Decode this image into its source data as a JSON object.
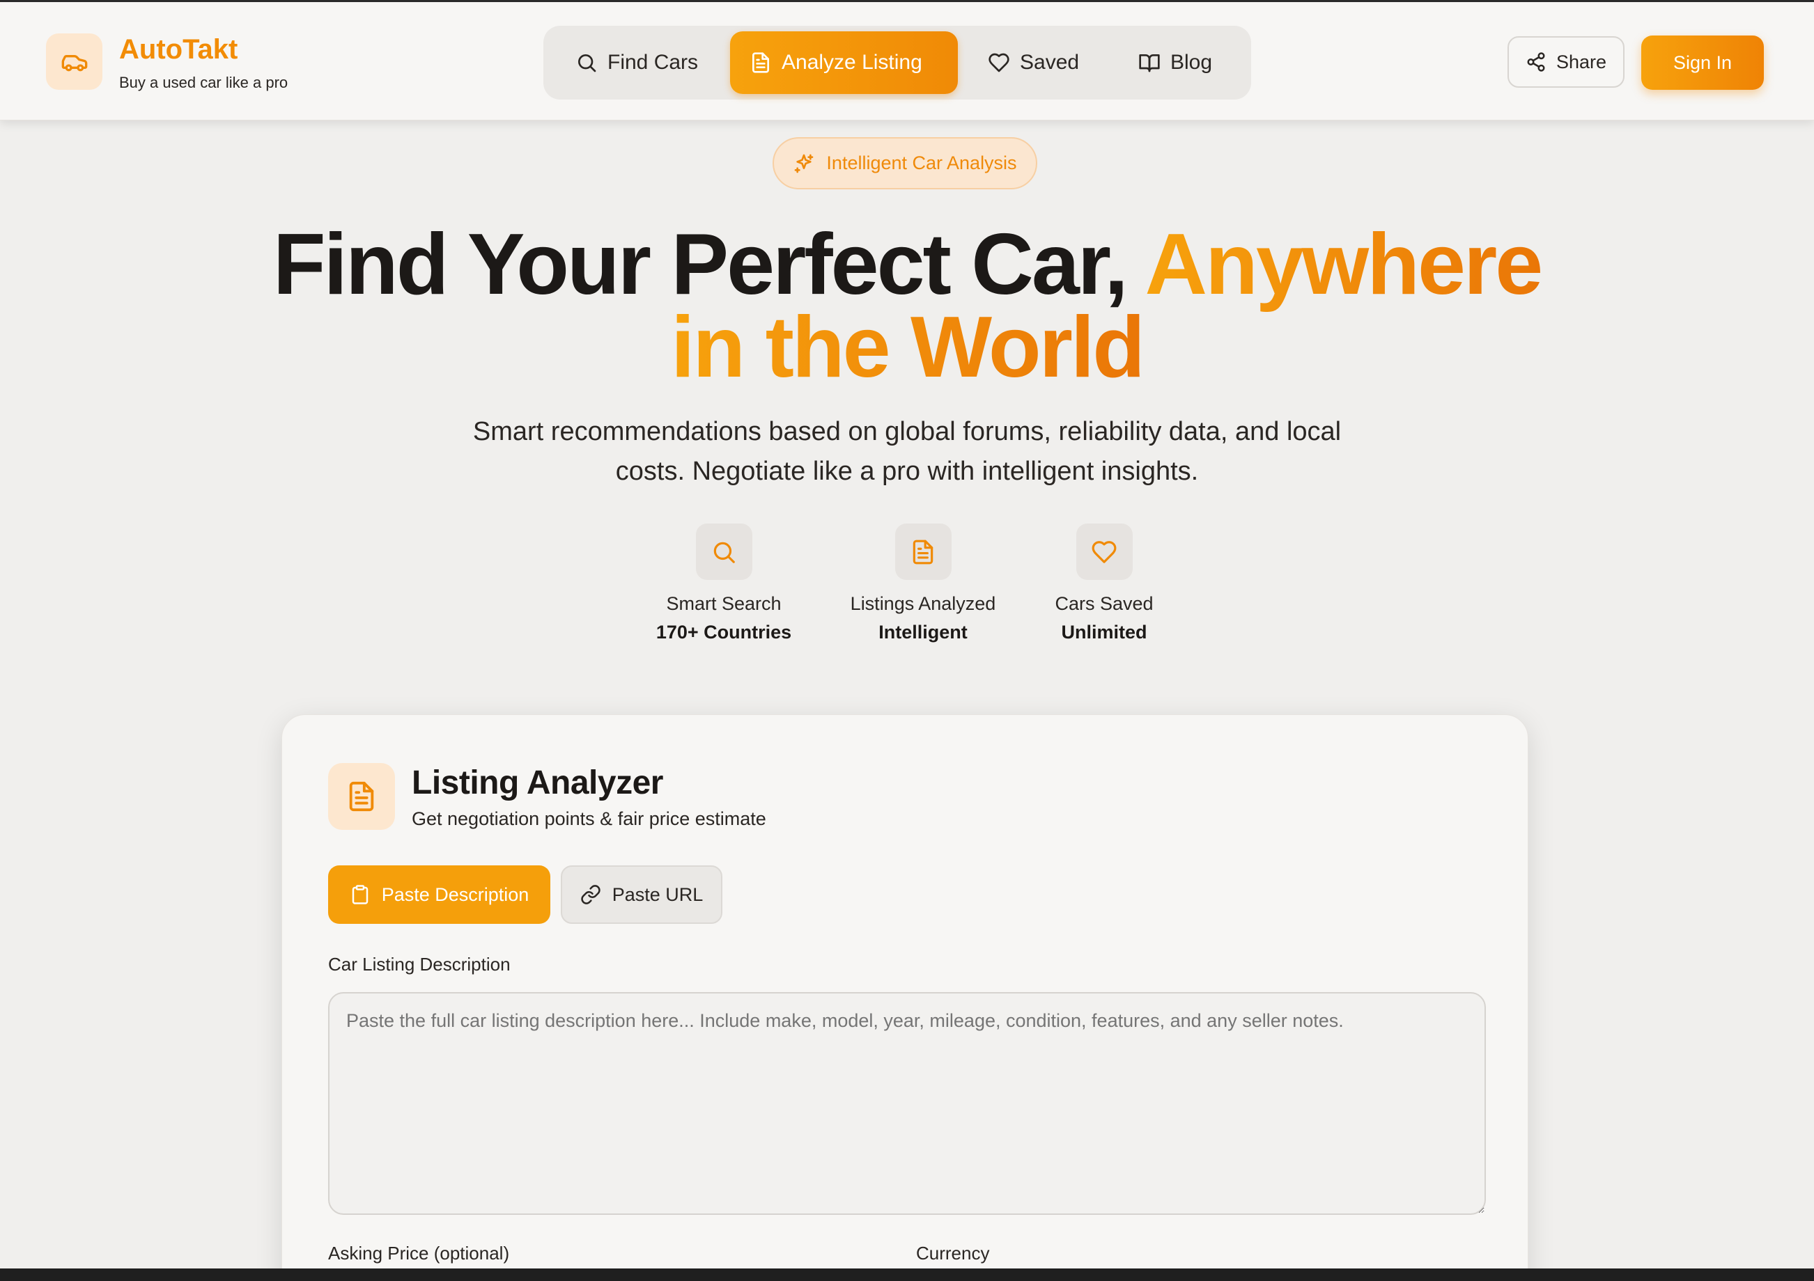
{
  "colors": {
    "accent": "#f28c06",
    "accent_light": "#fde7cf",
    "background": "#f0efed"
  },
  "header": {
    "brand_name": "AutoTakt",
    "tagline": "Buy a used car like a pro",
    "logo_icon": "car-icon",
    "nav": [
      {
        "label": "Find Cars",
        "icon": "search-icon",
        "active": false
      },
      {
        "label": "Analyze Listing",
        "icon": "document-icon",
        "active": true
      },
      {
        "label": "Saved",
        "icon": "heart-icon",
        "active": false
      },
      {
        "label": "Blog",
        "icon": "book-icon",
        "active": false
      }
    ],
    "share_label": "Share",
    "signin_label": "Sign In"
  },
  "hero": {
    "badge": "Intelligent Car Analysis",
    "headline_dark": "Find Your Perfect Car, ",
    "headline_accent_1": "Anywhere",
    "headline_accent_2": "in the World",
    "subtitle": "Smart recommendations based on global forums, reliability data, and local costs. Negotiate like a pro with intelligent insights.",
    "stats": [
      {
        "label": "Smart Search",
        "value": "170+ Countries",
        "icon": "search-icon"
      },
      {
        "label": "Listings Analyzed",
        "value": "Intelligent",
        "icon": "document-icon"
      },
      {
        "label": "Cars Saved",
        "value": "Unlimited",
        "icon": "heart-icon"
      }
    ]
  },
  "analyzer": {
    "title": "Listing Analyzer",
    "subtitle": "Get negotiation points & fair price estimate",
    "tabs": [
      {
        "label": "Paste Description",
        "icon": "clipboard-icon",
        "active": true
      },
      {
        "label": "Paste URL",
        "icon": "link-icon",
        "active": false
      }
    ],
    "description_label": "Car Listing Description",
    "description_placeholder": "Paste the full car listing description here... Include make, model, year, mileage, condition, features, and any seller notes.",
    "price_label": "Asking Price (optional)",
    "currency_label": "Currency"
  }
}
